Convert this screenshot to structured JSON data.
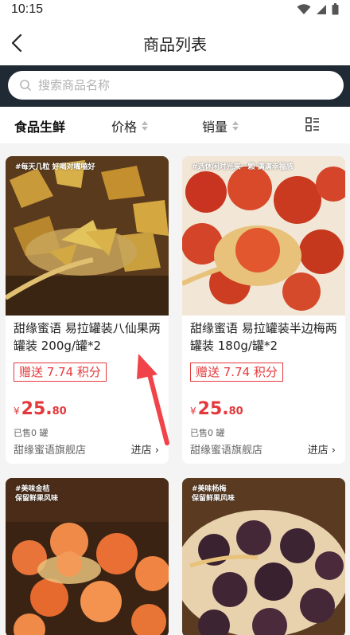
{
  "status": {
    "time": "10:15"
  },
  "header": {
    "title": "商品列表"
  },
  "search": {
    "placeholder": "搜索商品名称"
  },
  "filters": {
    "category": "食品生鲜",
    "price": "价格",
    "sales": "销量"
  },
  "colors": {
    "accent": "#e4393c",
    "search_bar_bg": "#1f2a35",
    "arrow": "#f0434a"
  },
  "products": [
    {
      "tag": "#每天几粒 好喝对嘴嗑好",
      "name": "甜缘蜜语 易拉罐装八仙果两罐装 200g/罐*2",
      "points": "赠送 7.74 积分",
      "currency": "¥",
      "price_int": "25.",
      "price_dec": "80",
      "sold": "已售0 罐",
      "shop": "甜缘蜜语旗舰店",
      "enter": "进店"
    },
    {
      "tag": "#选休闲时光来一颗 满满幸福感",
      "name": "甜缘蜜语 易拉罐装半边梅两罐装 180g/罐*2",
      "points": "赠送 7.74 积分",
      "currency": "¥",
      "price_int": "25.",
      "price_dec": "80",
      "sold": "已售0 罐",
      "shop": "甜缘蜜语旗舰店",
      "enter": "进店"
    },
    {
      "tag_line1": "#美味金桔",
      "tag_line2": "保留鲜果风味"
    },
    {
      "tag_line1": "#美味杨梅",
      "tag_line2": "保留鲜果风味"
    }
  ]
}
